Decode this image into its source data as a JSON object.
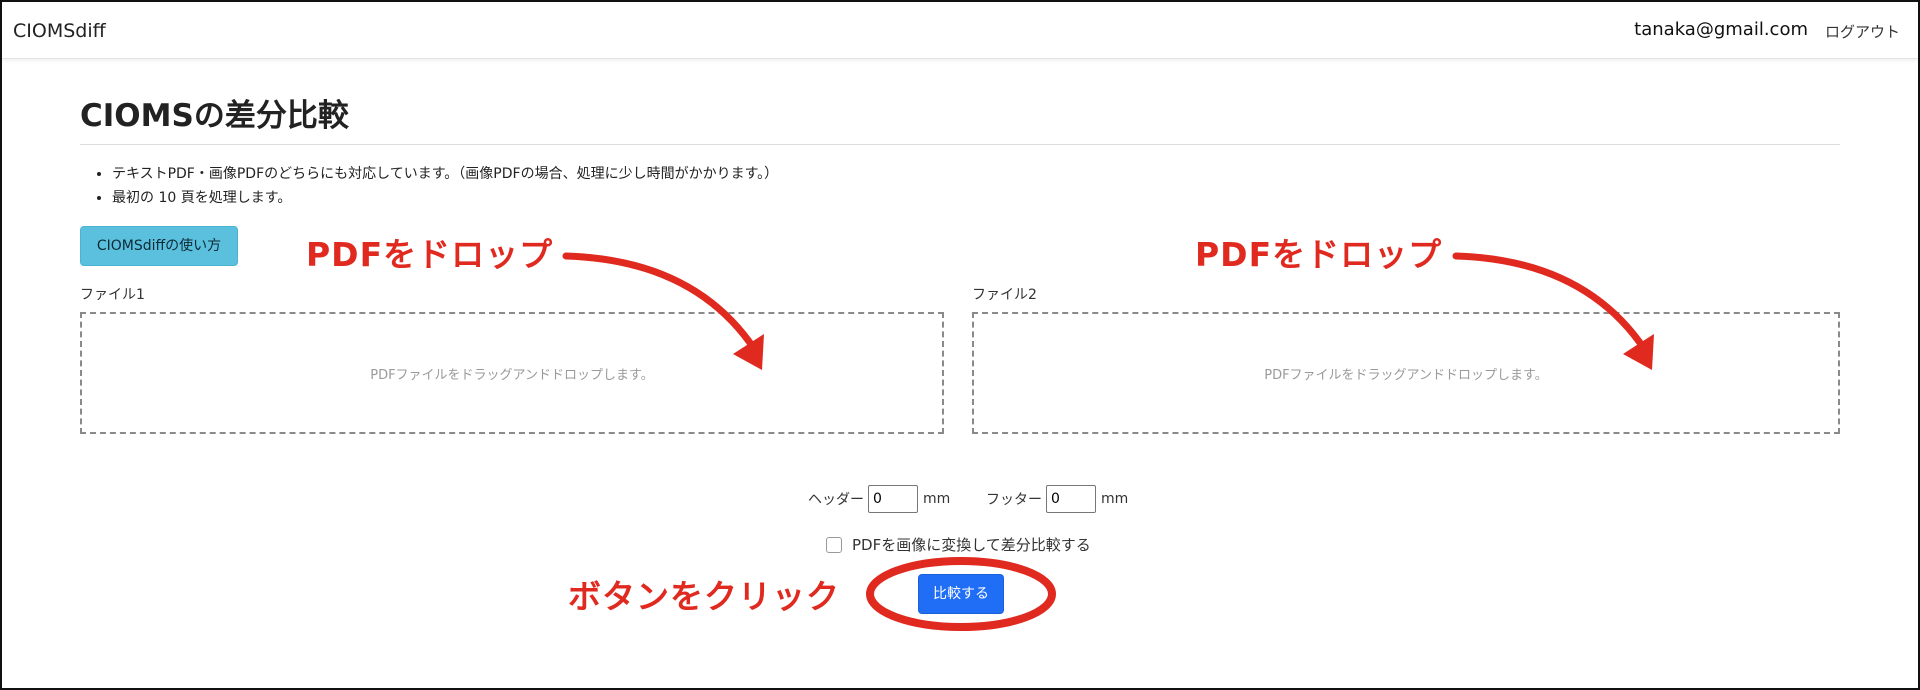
{
  "navbar": {
    "brand": "CIOMSdiff",
    "user_email": "tanaka@gmail.com",
    "logout_label": "ログアウト"
  },
  "main": {
    "title": "CIOMSの差分比較",
    "info_items": [
      "テキストPDF・画像PDFのどちらにも対応しています。（画像PDFの場合、処理に少し時間がかかります。）",
      "最初の 10 頁を処理します。"
    ],
    "howto_button_label": "CIOMSdiffの使い方",
    "file1": {
      "label": "ファイル1",
      "dropzone_text": "PDFファイルをドラッグアンドドロップします。"
    },
    "file2": {
      "label": "ファイル2",
      "dropzone_text": "PDFファイルをドラッグアンドドロップします。"
    },
    "header_option": {
      "label": "ヘッダー",
      "value": "0",
      "unit": "mm"
    },
    "footer_option": {
      "label": "フッター",
      "value": "0",
      "unit": "mm"
    },
    "convert_checkbox_label": "PDFを画像に変換して差分比較する",
    "convert_checkbox_checked": false,
    "compare_button_label": "比較する"
  },
  "annotations": {
    "drop_hint_1": "PDFをドロップ",
    "drop_hint_2": "PDFをドロップ",
    "click_hint": "ボタンをクリック",
    "color": "#e0291f"
  }
}
